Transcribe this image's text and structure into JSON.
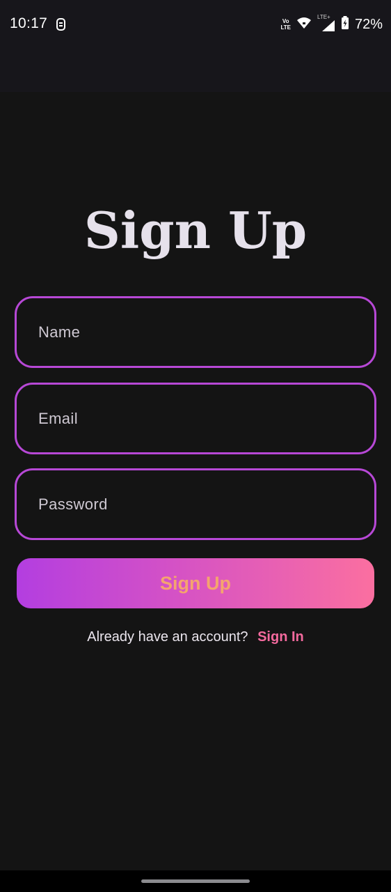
{
  "status_bar": {
    "time": "10:17",
    "volte_top": "Vo",
    "volte_bottom": "LTE",
    "lte_label": "LTE+",
    "battery": "72%",
    "icons": [
      "sync-icon",
      "volte-icon",
      "wifi-icon",
      "signal-icon",
      "battery-charging-icon"
    ]
  },
  "title": "Sign Up",
  "form": {
    "name_placeholder": "Name",
    "email_placeholder": "Email",
    "password_placeholder": "Password",
    "submit_label": "Sign Up"
  },
  "footer": {
    "prompt": "Already have an account?",
    "link_label": "Sign In"
  },
  "colors": {
    "background": "#141414",
    "field_border": "#b748d6",
    "button_gradient_start": "#b33ee0",
    "button_gradient_end": "#fb6fa0",
    "button_text": "#f5a46e",
    "link": "#f46a9e"
  }
}
